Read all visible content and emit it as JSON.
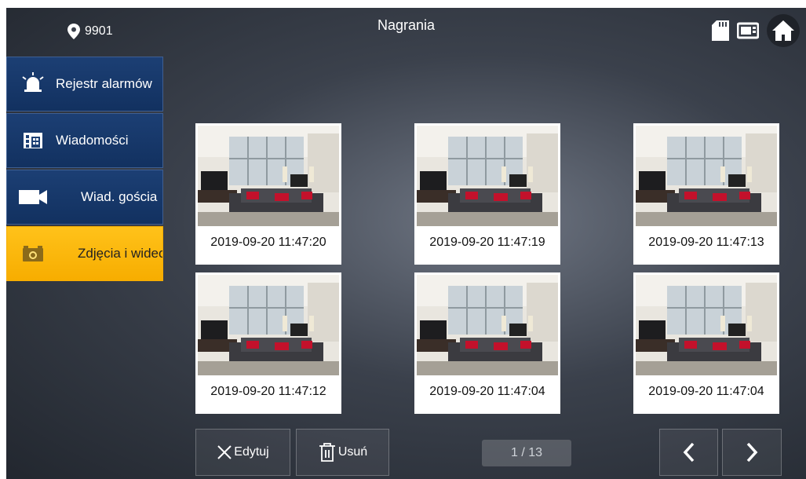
{
  "header": {
    "title": "Nagrania",
    "location_number": "9901"
  },
  "sidebar": {
    "items": [
      {
        "label": "Rejestr alarmów",
        "icon": "alarm-icon",
        "active": false
      },
      {
        "label": "Wiadomości",
        "icon": "building-icon",
        "active": false
      },
      {
        "label": "Wiad. gościa",
        "icon": "video-camera-icon",
        "active": false
      },
      {
        "label": "Zdjęcia i wideo",
        "icon": "camera-icon",
        "active": true
      }
    ]
  },
  "recordings": [
    {
      "timestamp": "2019-09-20 11:47:20"
    },
    {
      "timestamp": "2019-09-20 11:47:19"
    },
    {
      "timestamp": "2019-09-20 11:47:13"
    },
    {
      "timestamp": "2019-09-20 11:47:12"
    },
    {
      "timestamp": "2019-09-20 11:47:04"
    },
    {
      "timestamp": "2019-09-20 11:47:04"
    }
  ],
  "toolbar": {
    "edit_label": "Edytuj",
    "delete_label": "Usuń",
    "page_indicator": "1 / 13"
  },
  "colors": {
    "active_item": "#ffc21a",
    "sidebar_item": "#1c3f74"
  }
}
